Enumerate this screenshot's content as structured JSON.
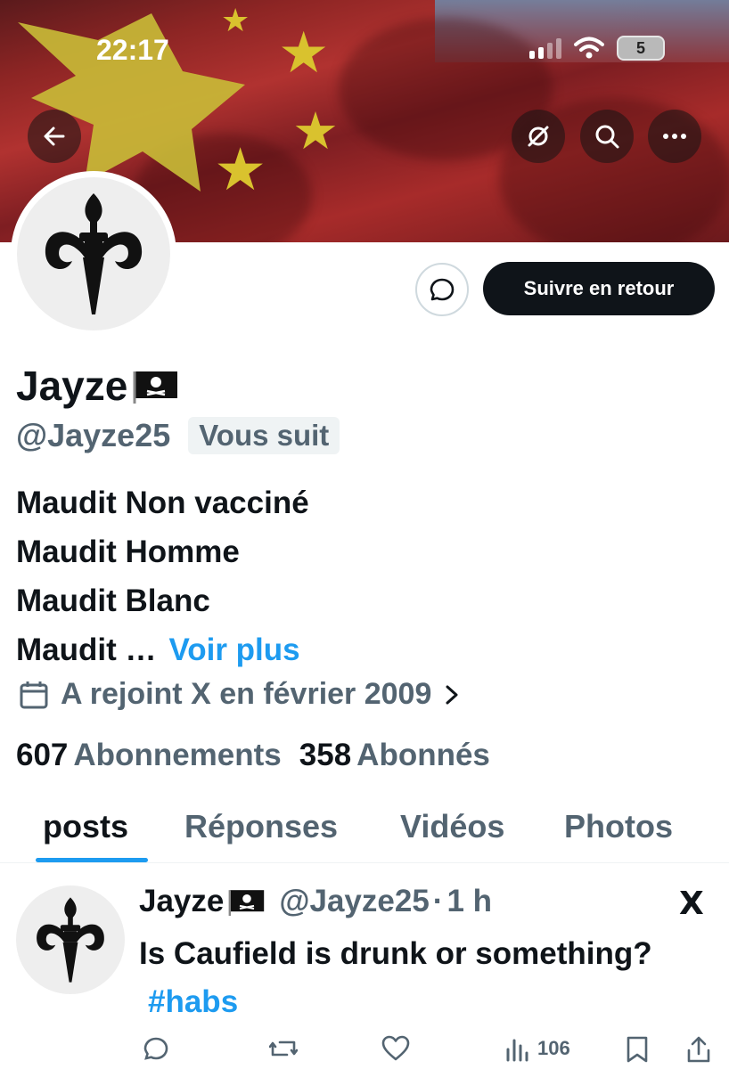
{
  "status_bar": {
    "time": "22:17",
    "battery": "5"
  },
  "profile": {
    "display_name": "Jayze",
    "handle": "@Jayze25",
    "follows_you": "Vous suit",
    "follow_button": "Suivre en retour",
    "bio_lines": [
      "Maudit Non vacciné",
      "Maudit Homme",
      "Maudit Blanc",
      "Maudit …"
    ],
    "bio_more": "Voir plus",
    "joined": "A rejoint X en février 2009",
    "following_count": "607",
    "following_label": "Abonnements",
    "followers_count": "358",
    "followers_label": "Abonnés"
  },
  "tabs": [
    {
      "label": "posts",
      "active": true
    },
    {
      "label": "Réponses",
      "active": false
    },
    {
      "label": "Vidéos",
      "active": false
    },
    {
      "label": "Photos",
      "active": false
    }
  ],
  "post": {
    "name": "Jayze",
    "handle": "@Jayze25",
    "separator": "·",
    "time": "1 h",
    "text": "Is Caufield is drunk or something?",
    "hashtag": "#habs",
    "views": "106",
    "source_logo": "X"
  },
  "icons": {
    "back": "arrow-left-icon",
    "translate": "translate-icon",
    "search": "search-icon",
    "more": "more-icon",
    "message": "message-icon",
    "calendar": "calendar-icon",
    "pirate_flag": "pirate-flag-icon"
  },
  "colors": {
    "accent": "#1d9bf0",
    "text": "#0f1419",
    "secondary": "#536471"
  }
}
